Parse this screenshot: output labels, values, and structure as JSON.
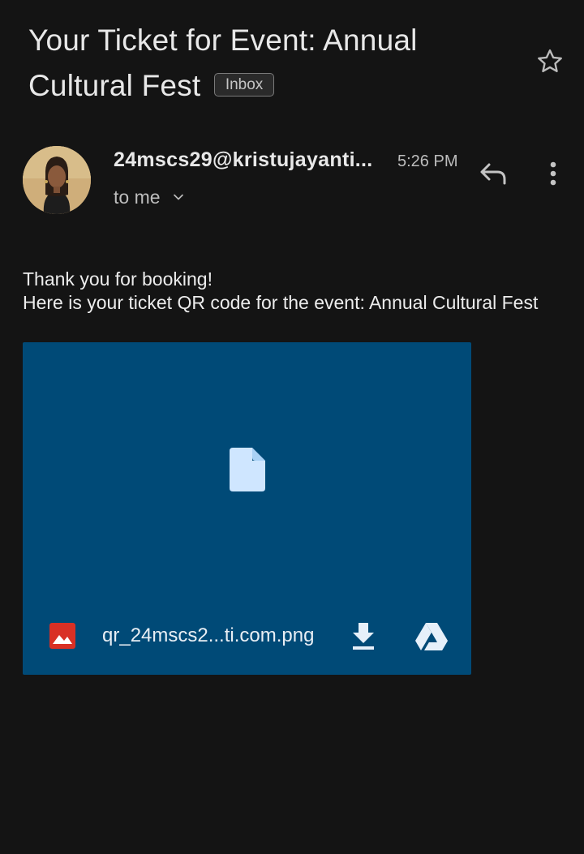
{
  "email": {
    "subject": "Your Ticket for Event: Annual Cultural Fest",
    "label": "Inbox",
    "sender": "24mscs29@kristujayanti...",
    "time": "5:26 PM",
    "recipient": "to me",
    "body_line1": "Thank you for booking!",
    "body_line2": "Here is your ticket QR code for the event: Annual Cultural Fest"
  },
  "attachment": {
    "filename": "qr_24mscs2...ti.com.png",
    "type_icon": "image-file-icon",
    "preview_icon": "generic-file-icon"
  },
  "icons": {
    "star": "star-outline-icon",
    "reply": "reply-arrow-icon",
    "more": "more-vert-icon",
    "chevron": "chevron-down-icon",
    "download": "download-icon",
    "drive": "google-drive-icon"
  },
  "colors": {
    "background": "#141414",
    "attachment_bg": "#004a77",
    "image_icon": "#d93025",
    "file_icon": "#cfe6ff"
  }
}
